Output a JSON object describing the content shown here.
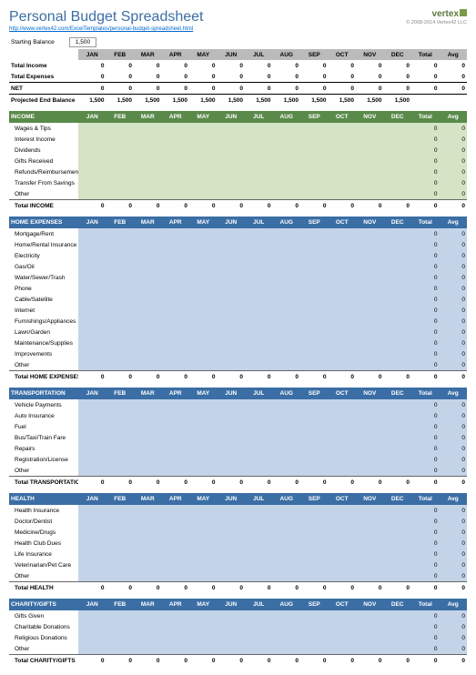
{
  "header": {
    "title": "Personal Budget Spreadsheet",
    "url": "http://www.vertex42.com/ExcelTemplates/personal-budget-spreadsheet.html",
    "logo": "vertex",
    "logo_suffix": "42",
    "copyright": "© 2008-2014 Vertex42 LLC"
  },
  "starting": {
    "label": "Starting Balance",
    "value": "1,500"
  },
  "months": [
    "JAN",
    "FEB",
    "MAR",
    "APR",
    "MAY",
    "JUN",
    "JUL",
    "AUG",
    "SEP",
    "OCT",
    "NOV",
    "DEC"
  ],
  "tcol": "Total",
  "acol": "Avg",
  "summary": {
    "rows": [
      {
        "label": "Total Income",
        "vals": [
          "0",
          "0",
          "0",
          "0",
          "0",
          "0",
          "0",
          "0",
          "0",
          "0",
          "0",
          "0"
        ],
        "total": "0",
        "avg": "0"
      },
      {
        "label": "Total Expenses",
        "vals": [
          "0",
          "0",
          "0",
          "0",
          "0",
          "0",
          "0",
          "0",
          "0",
          "0",
          "0",
          "0"
        ],
        "total": "0",
        "avg": "0"
      }
    ],
    "net": {
      "label": "NET",
      "vals": [
        "0",
        "0",
        "0",
        "0",
        "0",
        "0",
        "0",
        "0",
        "0",
        "0",
        "0",
        "0"
      ],
      "total": "0",
      "avg": "0"
    },
    "proj": {
      "label": "Projected End Balance",
      "vals": [
        "1,500",
        "1,500",
        "1,500",
        "1,500",
        "1,500",
        "1,500",
        "1,500",
        "1,500",
        "1,500",
        "1,500",
        "1,500",
        "1,500"
      ],
      "total": "",
      "avg": ""
    }
  },
  "sections": [
    {
      "name": "INCOME",
      "color": "g",
      "items": [
        "Wages & Tips",
        "Interest Income",
        "Dividends",
        "Gifts Received",
        "Refunds/Reimbursements",
        "Transfer From Savings",
        "Other"
      ],
      "total_label": "Total INCOME"
    },
    {
      "name": "HOME EXPENSES",
      "color": "b",
      "items": [
        "Mortgage/Rent",
        "Home/Rental Insurance",
        "Electricity",
        "Gas/Oil",
        "Water/Sewer/Trash",
        "Phone",
        "Cable/Satellite",
        "Internet",
        "Furnishings/Appliances",
        "Lawn/Garden",
        "Maintenance/Supplies",
        "Improvements",
        "Other"
      ],
      "total_label": "Total HOME EXPENSES"
    },
    {
      "name": "TRANSPORTATION",
      "color": "b",
      "items": [
        "Vehicle Payments",
        "Auto Insurance",
        "Fuel",
        "Bus/Taxi/Train Fare",
        "Repairs",
        "Registration/License",
        "Other"
      ],
      "total_label": "Total TRANSPORTATION"
    },
    {
      "name": "HEALTH",
      "color": "b",
      "items": [
        "Health Insurance",
        "Doctor/Dentist",
        "Medicine/Drugs",
        "Health Club Dues",
        "Life Insurance",
        "Veterinarian/Pet Care",
        "Other"
      ],
      "total_label": "Total HEALTH"
    },
    {
      "name": "CHARITY/GIFTS",
      "color": "b",
      "items": [
        "Gifts Given",
        "Charitable Donations",
        "Religious Donations",
        "Other"
      ],
      "total_label": "Total CHARITY/GIFTS"
    }
  ],
  "zero": "0"
}
